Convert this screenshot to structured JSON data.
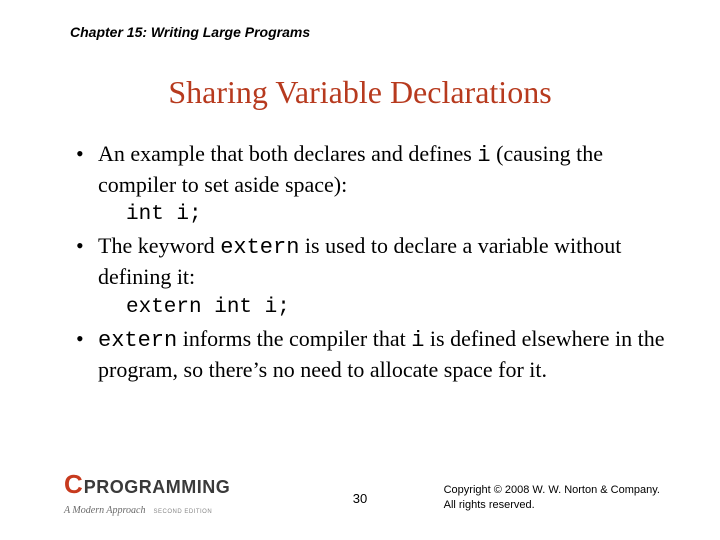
{
  "header": {
    "chapter": "Chapter 15: Writing Large Programs"
  },
  "title": "Sharing Variable Declarations",
  "bullets": [
    {
      "text_pre": "An example that both declares and defines ",
      "code_inline": "i",
      "text_post": " (causing the compiler to set aside space):",
      "code_block": "int i;"
    },
    {
      "text_pre": "The keyword ",
      "code_inline": "extern",
      "text_post": " is used to declare a variable without defining it:",
      "code_block": "extern int i;"
    },
    {
      "code_lead": "extern",
      "text_mid1": " informs the compiler that ",
      "code_mid": "i",
      "text_mid2": " is defined elsewhere in the program, so there’s no need to allocate space for it."
    }
  ],
  "footer": {
    "logo_c": "C",
    "logo_prog": "PROGRAMMING",
    "logo_sub": "A Modern Approach",
    "logo_ed": "SECOND EDITION",
    "page": "30",
    "copyright_line1": "Copyright © 2008 W. W. Norton & Company.",
    "copyright_line2": "All rights reserved."
  }
}
